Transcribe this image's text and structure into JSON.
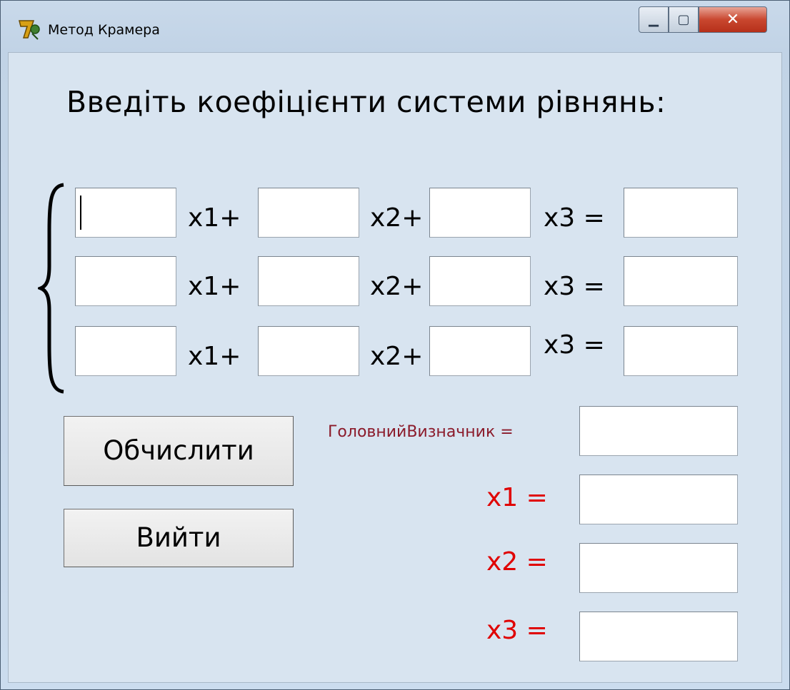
{
  "window": {
    "title": "Метод Крамера",
    "minimize_glyph": "▁",
    "maximize_glyph": "▢",
    "close_glyph": "✕",
    "icon": "delphi-icon"
  },
  "heading": "Введіть коефіцієнти системи рівнянь:",
  "equations": [
    {
      "x1_label": "x1+",
      "x2_label": "x2+",
      "x3_label": "x3 ="
    },
    {
      "x1_label": "x1+",
      "x2_label": "x2+",
      "x3_label": "x3 ="
    },
    {
      "x1_label": "x1+",
      "x2_label": "x2+",
      "x3_label": "x3 ="
    }
  ],
  "results": {
    "det_label": "ГоловнийВизначник =",
    "x1_label": "x1 =",
    "x2_label": "x2 =",
    "x3_label": "x3 ="
  },
  "buttons": {
    "calculate": "Обчислити",
    "exit": "Вийти"
  },
  "colors": {
    "result_label": "#e00000",
    "det_label": "#8b1a2a",
    "close_button": "#c9472f"
  }
}
